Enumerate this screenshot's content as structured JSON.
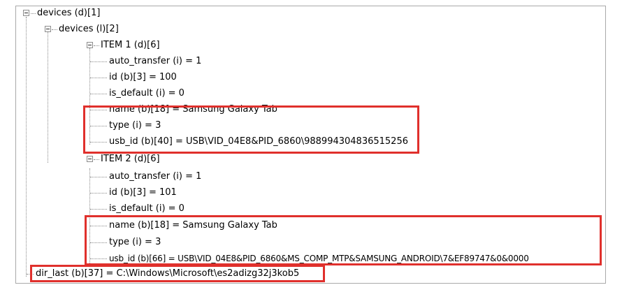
{
  "tree": {
    "root_label": "devices (d)[1]",
    "devices_list_label": "devices (l)[2]",
    "item1": {
      "label": "ITEM 1 (d)[6]",
      "auto_transfer": "auto_transfer (i) = 1",
      "id": "id (b)[3] = 100",
      "is_default": "is_default (i) = 0",
      "name": "name (b)[18] = Samsung Galaxy Tab",
      "type": "type (i) = 3",
      "usb_id": "usb_id (b)[40] = USB\\VID_04E8&PID_6860\\988994304836515256"
    },
    "item2": {
      "label": "ITEM 2 (d)[6]",
      "auto_transfer": "auto_transfer (i) = 1",
      "id": "id (b)[3] = 101",
      "is_default": "is_default (i) = 0",
      "name": "name (b)[18] = Samsung Galaxy Tab",
      "type": "type (i) = 3",
      "usb_id": "usb_id (b)[66] = USB\\VID_04E8&PID_6860&MS_COMP_MTP&SAMSUNG_ANDROID\\7&EF89747&0&0000"
    },
    "dir_last": "dir_last (b)[37] = C:\\Windows\\Microsoft\\es2adizg32j3kob5"
  },
  "colors": {
    "highlight": "#e0302c",
    "guide": "#8a8a8a"
  }
}
